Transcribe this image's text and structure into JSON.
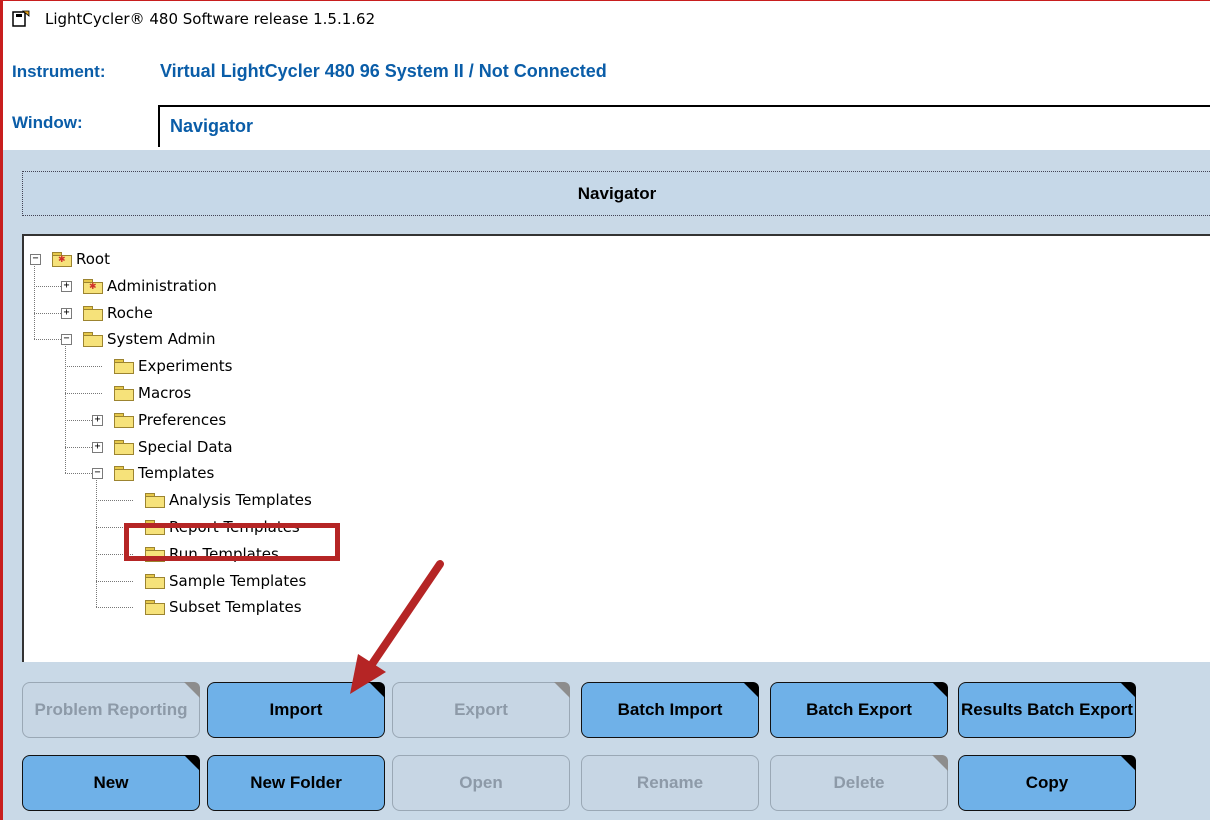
{
  "window": {
    "title": "LightCycler® 480 Software release 1.5.1.62"
  },
  "header": {
    "instrument_label": "Instrument:",
    "instrument_value": "Virtual LightCycler 480 96 System II / Not Connected",
    "window_label": "Window:",
    "window_value": "Navigator"
  },
  "navigator": {
    "title": "Navigator",
    "tree": [
      {
        "label": "Root",
        "expander": "minus",
        "special": true
      },
      {
        "label": "Administration",
        "expander": "plus",
        "special": true
      },
      {
        "label": "Roche",
        "expander": "plus"
      },
      {
        "label": "System Admin",
        "expander": "minus"
      },
      {
        "label": "Experiments"
      },
      {
        "label": "Macros"
      },
      {
        "label": "Preferences",
        "expander": "plus"
      },
      {
        "label": "Special Data",
        "expander": "plus"
      },
      {
        "label": "Templates",
        "expander": "minus"
      },
      {
        "label": "Analysis Templates"
      },
      {
        "label": "Report Templates"
      },
      {
        "label": "Run Templates",
        "highlighted": true
      },
      {
        "label": "Sample Templates"
      },
      {
        "label": "Subset Templates"
      }
    ]
  },
  "buttons": {
    "row1": [
      {
        "label": "Problem Reporting",
        "enabled": false
      },
      {
        "label": "Import",
        "enabled": true
      },
      {
        "label": "Export",
        "enabled": false
      },
      {
        "label": "Batch Import",
        "enabled": true
      },
      {
        "label": "Batch Export",
        "enabled": true
      },
      {
        "label": "Results Batch Export",
        "enabled": true
      }
    ],
    "row2": [
      {
        "label": "New",
        "enabled": true
      },
      {
        "label": "New Folder",
        "enabled": true
      },
      {
        "label": "Open",
        "enabled": false
      },
      {
        "label": "Rename",
        "enabled": false
      },
      {
        "label": "Delete",
        "enabled": false
      },
      {
        "label": "Copy",
        "enabled": true
      }
    ]
  },
  "colors": {
    "accent": "#0a5da8",
    "button": "#6fb1e8",
    "panel": "#c9d9e7",
    "highlight": "#b52525"
  }
}
